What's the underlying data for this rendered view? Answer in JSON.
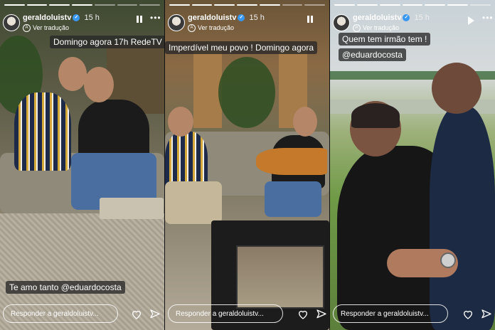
{
  "stories": [
    {
      "username": "geraldoluistv",
      "time": "15 h",
      "translate_label": "Ver tradução",
      "captions": [
        "Domingo agora 17h RedeTV",
        "Te amo tanto @eduardocosta"
      ],
      "reply_placeholder": "Responder a geraldoluistv...",
      "playback_icon": "pause-icon"
    },
    {
      "username": "geraldoluistv",
      "time": "15 h",
      "translate_label": "Ver tradução",
      "captions": [
        "Imperdível meu povo ! Domingo agora"
      ],
      "reply_placeholder": "Responder a geraldoluistv...",
      "playback_icon": "pause-icon"
    },
    {
      "username": "geraldoluistv",
      "time": "15 h",
      "translate_label": "Ver tradução",
      "captions": [
        "Quem tem irmão tem !",
        "@eduardocosta"
      ],
      "reply_placeholder": "Responder a geraldoluistv...",
      "playback_icon": "play-icon"
    }
  ],
  "colors": {
    "verified": "#3897f0",
    "caption_bg": "#282828"
  }
}
